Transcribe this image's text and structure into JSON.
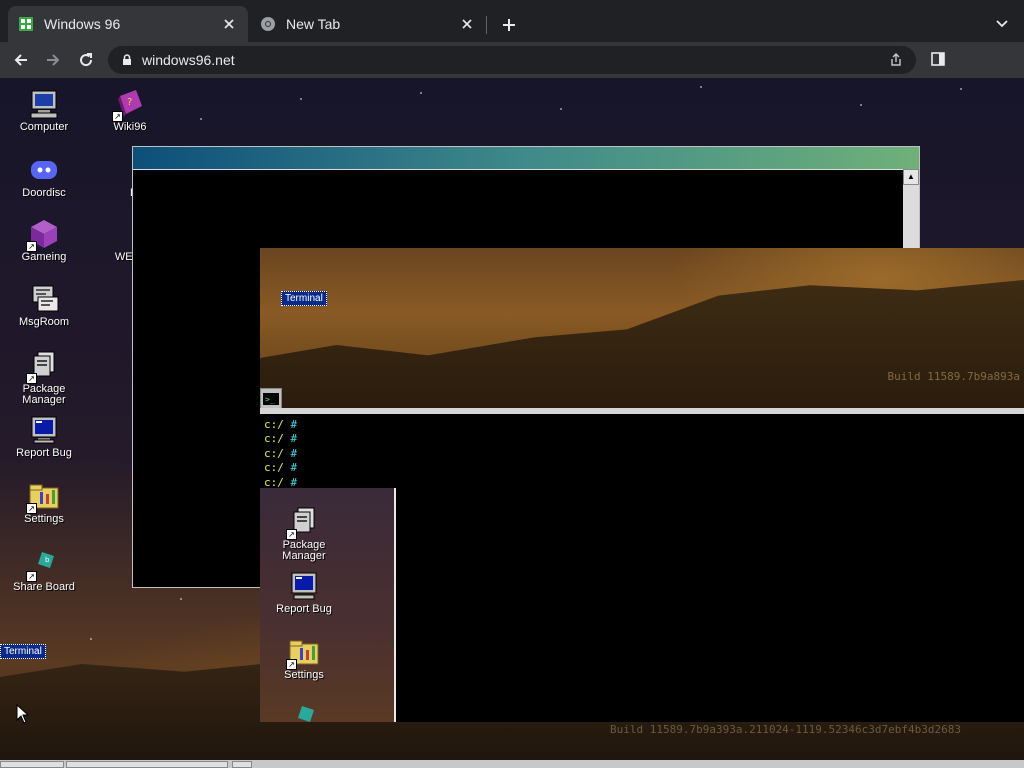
{
  "browser": {
    "tabs": [
      {
        "title": "Windows 96",
        "active": true,
        "favicon": "windows96-favicon"
      },
      {
        "title": "New Tab",
        "active": false,
        "favicon": "chrome-icon"
      }
    ],
    "address": "windows96.net"
  },
  "desktop": {
    "icons_col1": [
      {
        "label": "Computer",
        "icon": "computer-icon"
      },
      {
        "label": "Doordisc",
        "icon": "discord-icon"
      },
      {
        "label": "Gameing",
        "icon": "cube-icon"
      },
      {
        "label": "MsgRoom",
        "icon": "msgroom-icon"
      },
      {
        "label": "Package\nManager",
        "icon": "package-icon"
      },
      {
        "label": "Report Bug",
        "icon": "monitor-icon"
      },
      {
        "label": "Settings",
        "icon": "settings-icon"
      },
      {
        "label": "Share Board",
        "icon": "shareboard-icon"
      }
    ],
    "icons_col2": [
      {
        "label": "Wiki96",
        "icon": "book-icon"
      },
      {
        "label": "Do",
        "icon": "folder-icon"
      },
      {
        "label": "WELCO\nc",
        "icon": "document-icon"
      }
    ],
    "terminal_label": "Terminal"
  },
  "glitch_window": {
    "terminal_label": "Terminal",
    "build_text": "Build 11589.7b9a893a",
    "prompt_lines": [
      "c:/",
      "c:/",
      "c:/",
      "c:/",
      "c:/"
    ],
    "prompt_symbol": "#",
    "panel_icons": [
      {
        "label": "Package\nManager",
        "icon": "package-icon"
      },
      {
        "label": "Report Bug",
        "icon": "monitor-icon"
      },
      {
        "label": "Settings",
        "icon": "settings-icon"
      }
    ]
  },
  "bottom_build_text": "Build 11589.7b9a393a.211024-1119.52346c3d7ebf4b3d2683"
}
